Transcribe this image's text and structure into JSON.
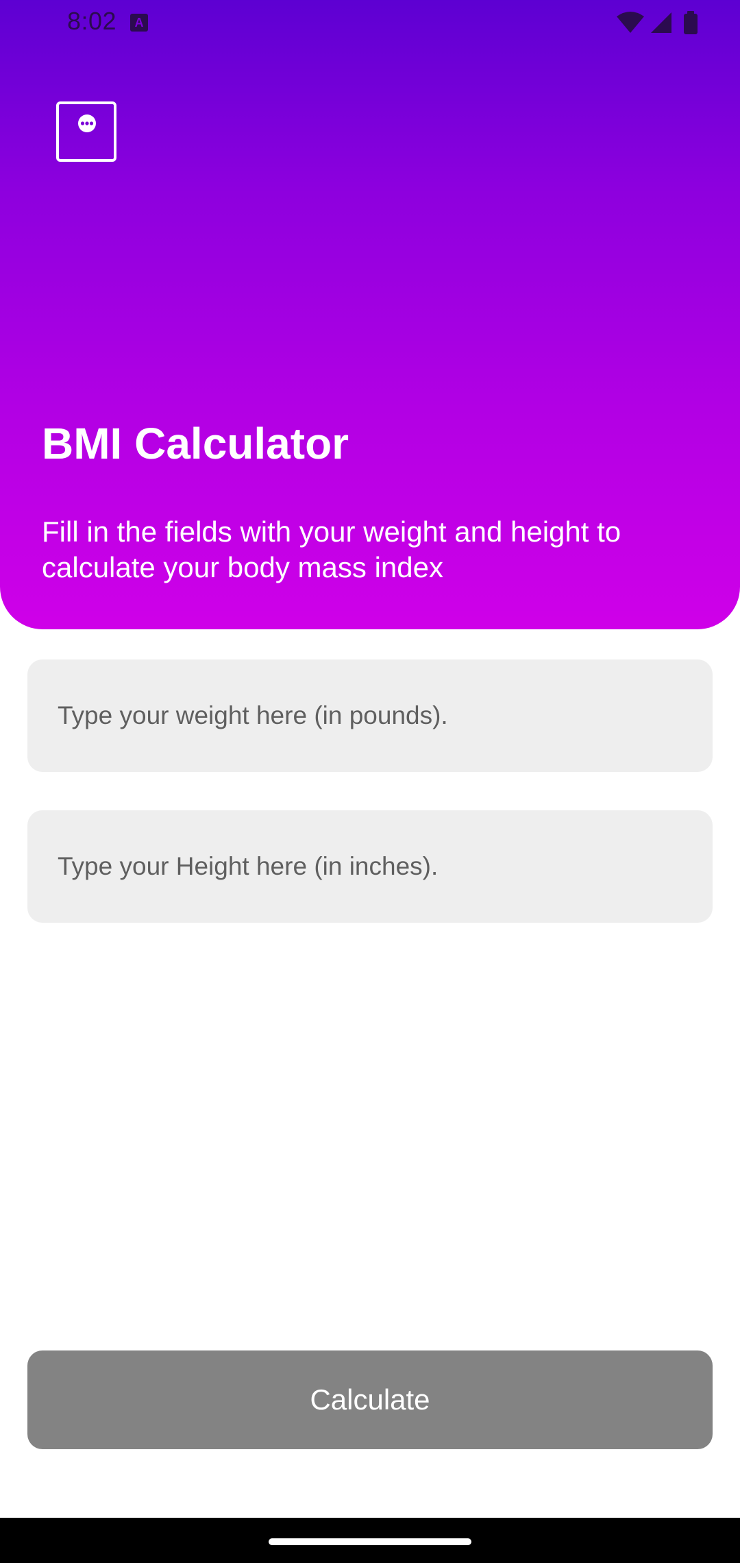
{
  "status_bar": {
    "time": "8:02",
    "notification_icon": "keyboard-a-icon",
    "icons": [
      "wifi-icon",
      "cell-signal-icon",
      "battery-icon"
    ]
  },
  "header": {
    "menu_icon": "menu-dots-icon",
    "title": "BMI Calculator",
    "subtitle": "Fill in the fields with your weight and height to calculate your body mass index",
    "gradient_top": "#5d00d2",
    "gradient_bottom": "#cf00e8"
  },
  "form": {
    "weight": {
      "value": "",
      "placeholder": "Type your weight here (in pounds)."
    },
    "height": {
      "value": "",
      "placeholder": "Type your Height here (in inches)."
    },
    "calculate_label": "Calculate",
    "button_color": "#838383"
  }
}
